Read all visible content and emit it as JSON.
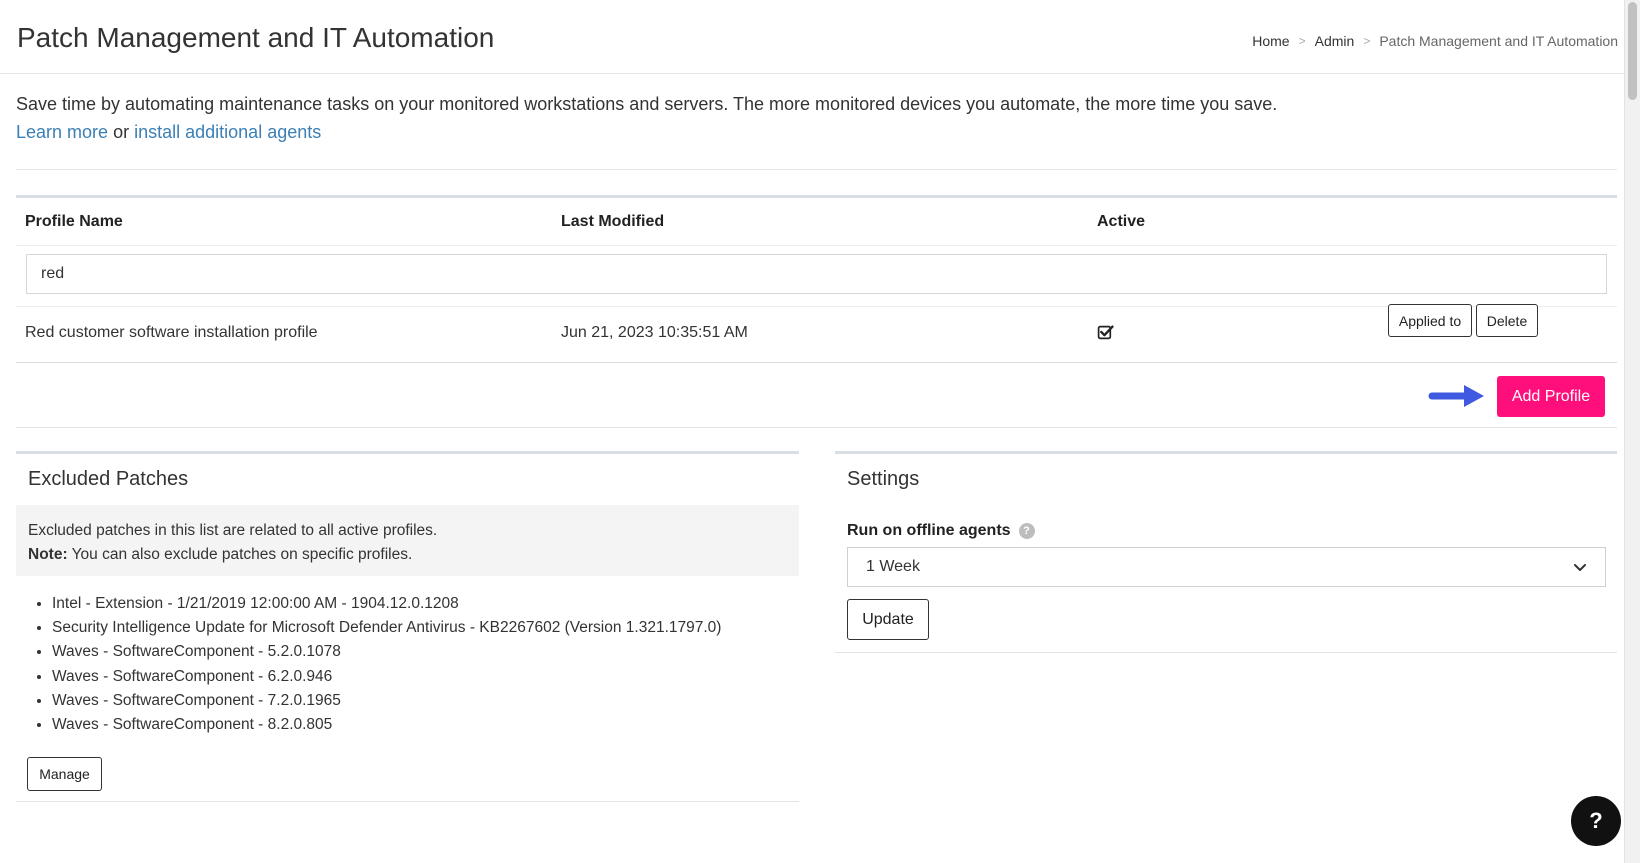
{
  "header": {
    "title": "Patch Management and IT Automation",
    "breadcrumb": [
      "Home",
      "Admin",
      "Patch Management and IT Automation"
    ]
  },
  "intro": {
    "text": "Save time by automating maintenance tasks on your monitored workstations and servers. The more monitored devices you automate, the more time you save.",
    "learn_more": "Learn more",
    "or": "or",
    "install_agents": "install additional agents"
  },
  "profiles": {
    "columns": [
      "Profile Name",
      "Last Modified",
      "Active"
    ],
    "filter_value": "red",
    "rows": [
      {
        "name": "Red customer software installation profile",
        "last_modified": "Jun 21, 2023 10:35:51 AM",
        "active": true,
        "applied_to_label": "Applied to",
        "delete_label": "Delete"
      }
    ],
    "add_profile_label": "Add Profile"
  },
  "excluded_patches": {
    "title": "Excluded Patches",
    "note_line1": "Excluded patches in this list are related to all active profiles.",
    "note_bold": "Note:",
    "note_line2": "You can also exclude patches on specific profiles.",
    "items": [
      "Intel - Extension - 1/21/2019 12:00:00 AM - 1904.12.0.1208",
      "Security Intelligence Update for Microsoft Defender Antivirus - KB2267602 (Version 1.321.1797.0)",
      "Waves - SoftwareComponent - 5.2.0.1078",
      "Waves - SoftwareComponent - 6.2.0.946",
      "Waves - SoftwareComponent - 7.2.0.1965",
      "Waves - SoftwareComponent - 8.2.0.805"
    ],
    "manage_label": "Manage"
  },
  "settings": {
    "title": "Settings",
    "run_offline_label": "Run on offline agents",
    "help_glyph": "?",
    "run_offline_value": "1 Week",
    "update_label": "Update"
  },
  "help_fab": "?",
  "colors": {
    "accent_pink": "#ff0f7b",
    "link_blue": "#3b7fb5",
    "arrow_blue": "#3f5ae0"
  }
}
